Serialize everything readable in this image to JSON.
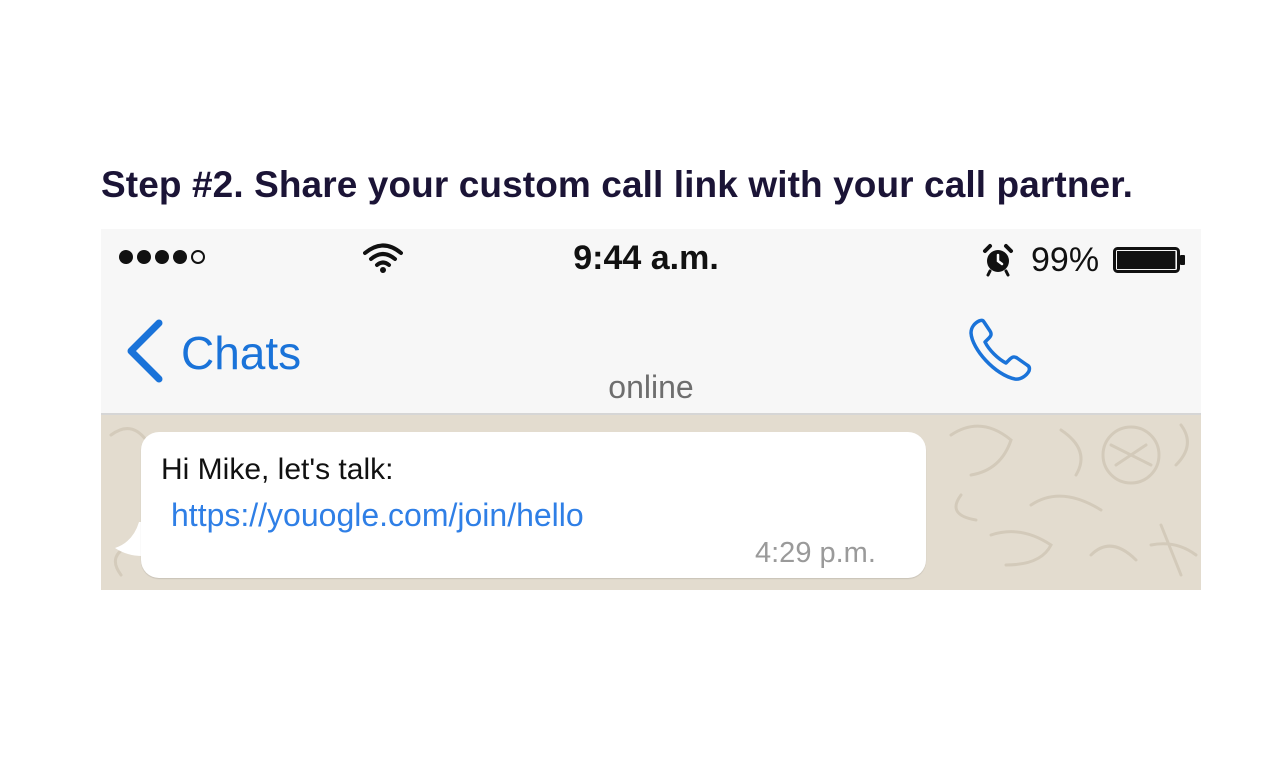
{
  "heading": "Step #2. Share your custom call link with your call partner.",
  "status_bar": {
    "signal_bars_filled": 4,
    "signal_bars_total": 5,
    "wifi_icon": "wifi-icon",
    "time": "9:44 a.m.",
    "alarm_icon": "alarm-clock-icon",
    "battery_percent": "99%",
    "battery_level": 0.99
  },
  "nav": {
    "back_icon": "chevron-left-icon",
    "back_label": "Chats",
    "subtitle": "online",
    "call_icon": "phone-icon"
  },
  "message": {
    "text": "Hi Mike, let's talk:",
    "link": "https://youogle.com/join/hello",
    "time": "4:29 p.m."
  },
  "colors": {
    "heading": "#1b1436",
    "accent": "#1a73d9",
    "link": "#2f7fe6",
    "chat_background": "#e3dccf",
    "bubble": "#ffffff"
  }
}
